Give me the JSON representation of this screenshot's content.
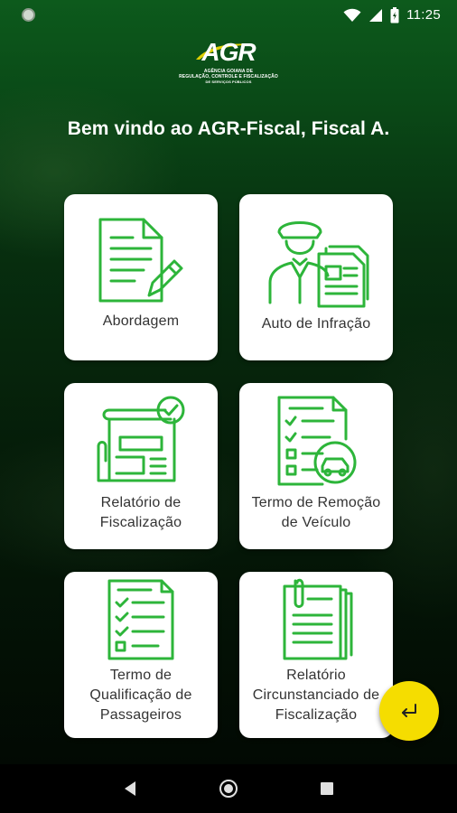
{
  "status_bar": {
    "time": "11:25",
    "icons": [
      "notification-dot-icon",
      "wifi-icon",
      "cell-signal-icon",
      "battery-icon"
    ]
  },
  "logo": {
    "text": "AGR",
    "subtitle_line1": "Agência Goiana de",
    "subtitle_line2": "Regulação, Controle e Fiscalização",
    "subtitle_line3": "de Serviços Públicos"
  },
  "welcome": "Bem vindo ao AGR-Fiscal, Fiscal A.",
  "cards": [
    {
      "line1": "Abordagem",
      "line2": "",
      "line3": "",
      "icon": "document-pencil-icon"
    },
    {
      "line1": "Auto de Infração",
      "line2": "",
      "line3": "",
      "icon": "officer-document-icon"
    },
    {
      "line1": "Relatório de",
      "line2": "Fiscalização",
      "line3": "",
      "icon": "report-check-icon"
    },
    {
      "line1": "Termo de Remoção",
      "line2": "de Veículo",
      "line3": "",
      "icon": "checklist-car-icon"
    },
    {
      "line1": "Termo de",
      "line2": "Qualificação de",
      "line3": "Passageiros",
      "icon": "checklist-icon"
    },
    {
      "line1": "Relatório",
      "line2": "Circunstanciado de",
      "line3": "Fiscalização",
      "icon": "clipboard-stack-icon"
    }
  ],
  "fab": {
    "icon": "enter-return-icon"
  },
  "colors": {
    "accent_green": "#2db53a",
    "fab_yellow": "#f5dd00",
    "card_bg": "#ffffff",
    "text_dark": "#333333"
  },
  "nav": [
    "back-icon",
    "home-icon",
    "recents-icon"
  ]
}
